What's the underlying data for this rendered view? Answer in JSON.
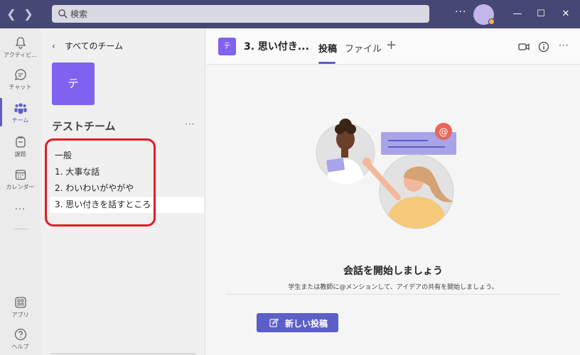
{
  "search": {
    "placeholder": "検索"
  },
  "titlebar": {
    "more": "···",
    "minimize": "—",
    "maximize": "☐",
    "close": "✕"
  },
  "rail": {
    "items": [
      {
        "label": "アクティビ...",
        "icon": "bell-icon"
      },
      {
        "label": "チャット",
        "icon": "chat-icon"
      },
      {
        "label": "チーム",
        "icon": "teams-icon",
        "active": true
      },
      {
        "label": "課題",
        "icon": "assignments-icon"
      },
      {
        "label": "カレンダー",
        "icon": "calendar-icon"
      },
      {
        "label": "···",
        "icon": "more-icon"
      },
      {
        "label": "アプリ",
        "icon": "apps-icon"
      },
      {
        "label": "ヘルプ",
        "icon": "help-icon"
      }
    ]
  },
  "team_panel": {
    "back_label": "すべてのチーム",
    "tile_initial": "テ",
    "team_name": "テストチーム",
    "more": "···",
    "channels": [
      {
        "label": "一般"
      },
      {
        "label": "1. 大事な話"
      },
      {
        "label": "2. わいわいがやがや"
      },
      {
        "label": "3. 思い付きを話すところ",
        "selected": true
      }
    ]
  },
  "main": {
    "channel_initial": "テ",
    "channel_title": "3. 思い付き...",
    "tabs": [
      {
        "label": "投稿",
        "active": true
      },
      {
        "label": "ファイル"
      }
    ],
    "add_tab": "+",
    "more": "···",
    "empty_title": "会話を開始しましょう",
    "empty_subtitle": "学生または教師に@メンションして、アイデアの共有を開始しましょう。",
    "new_post_label": "新しい投稿"
  },
  "colors": {
    "titlebar": "#464775",
    "accent": "#5b5fc7",
    "team_tile": "#7f62f0",
    "highlight_outline": "#e31b23"
  }
}
